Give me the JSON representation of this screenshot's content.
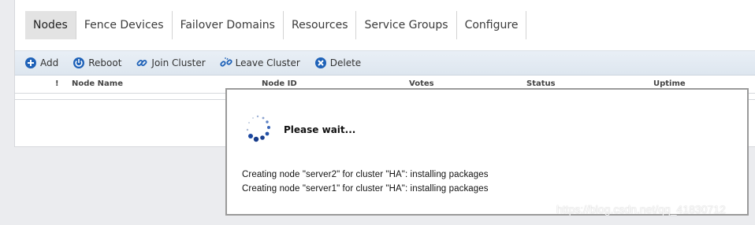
{
  "tabs": [
    {
      "label": "Nodes",
      "active": true
    },
    {
      "label": "Fence Devices"
    },
    {
      "label": "Failover Domains"
    },
    {
      "label": "Resources"
    },
    {
      "label": "Service Groups"
    },
    {
      "label": "Configure"
    }
  ],
  "toolbar": {
    "add_label": "Add",
    "reboot_label": "Reboot",
    "join_label": "Join Cluster",
    "leave_label": "Leave Cluster",
    "delete_label": "Delete"
  },
  "table": {
    "headers": {
      "flag": "!",
      "node_name": "Node Name",
      "node_id": "Node ID",
      "votes": "Votes",
      "status": "Status",
      "uptime": "Uptime"
    }
  },
  "dialog": {
    "title": "Please wait...",
    "messages": [
      "Creating node \"server2\" for cluster \"HA\": installing packages",
      "Creating node \"server1\" for cluster \"HA\": installing packages"
    ]
  },
  "watermark": "https://blog.csdn.net/qq_41830712",
  "colors": {
    "accent": "#1f62b8",
    "toolbar_bg": "#e4ebf3",
    "active_tab_bg": "#e3e3e3"
  },
  "icons": {
    "add": "plus-circle-icon",
    "reboot": "power-icon",
    "join": "link-icon",
    "leave": "broken-link-icon",
    "delete": "x-circle-icon",
    "spinner": "loading-spinner-icon"
  }
}
